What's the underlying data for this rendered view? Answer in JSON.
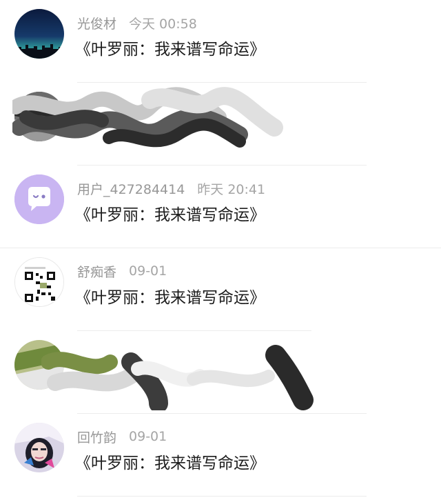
{
  "comments": [
    {
      "username": "光俊材",
      "time": "今天 00:58",
      "content": "《叶罗丽：我来谱写命运》",
      "avatar_icon": "city-night-avatar",
      "redacted": false
    },
    {
      "username": "",
      "time": "",
      "content": "",
      "avatar_icon": "redacted-avatar",
      "redacted": true
    },
    {
      "username": "用户_427284414",
      "time": "昨天 20:41",
      "content": "《叶罗丽：我来谱写命运》",
      "avatar_icon": "chat-bubble-avatar",
      "redacted": false
    },
    {
      "username": "舒痴香",
      "time": "09-01",
      "content": "《叶罗丽：我来谱写命运》",
      "avatar_icon": "qr-code-avatar",
      "redacted": false
    },
    {
      "username": "",
      "time": "",
      "content": "",
      "avatar_icon": "redacted-avatar",
      "redacted": true
    },
    {
      "username": "回竹韵",
      "time": "09-01",
      "content": "《叶罗丽：我来谱写命运》",
      "avatar_icon": "photo-girl-avatar",
      "redacted": false
    }
  ],
  "colors": {
    "username": "#979797",
    "time": "#a5a5a5",
    "content": "#1c1c1c",
    "divider": "#ececec",
    "chat_avatar_bg": "#c9b5f2"
  }
}
